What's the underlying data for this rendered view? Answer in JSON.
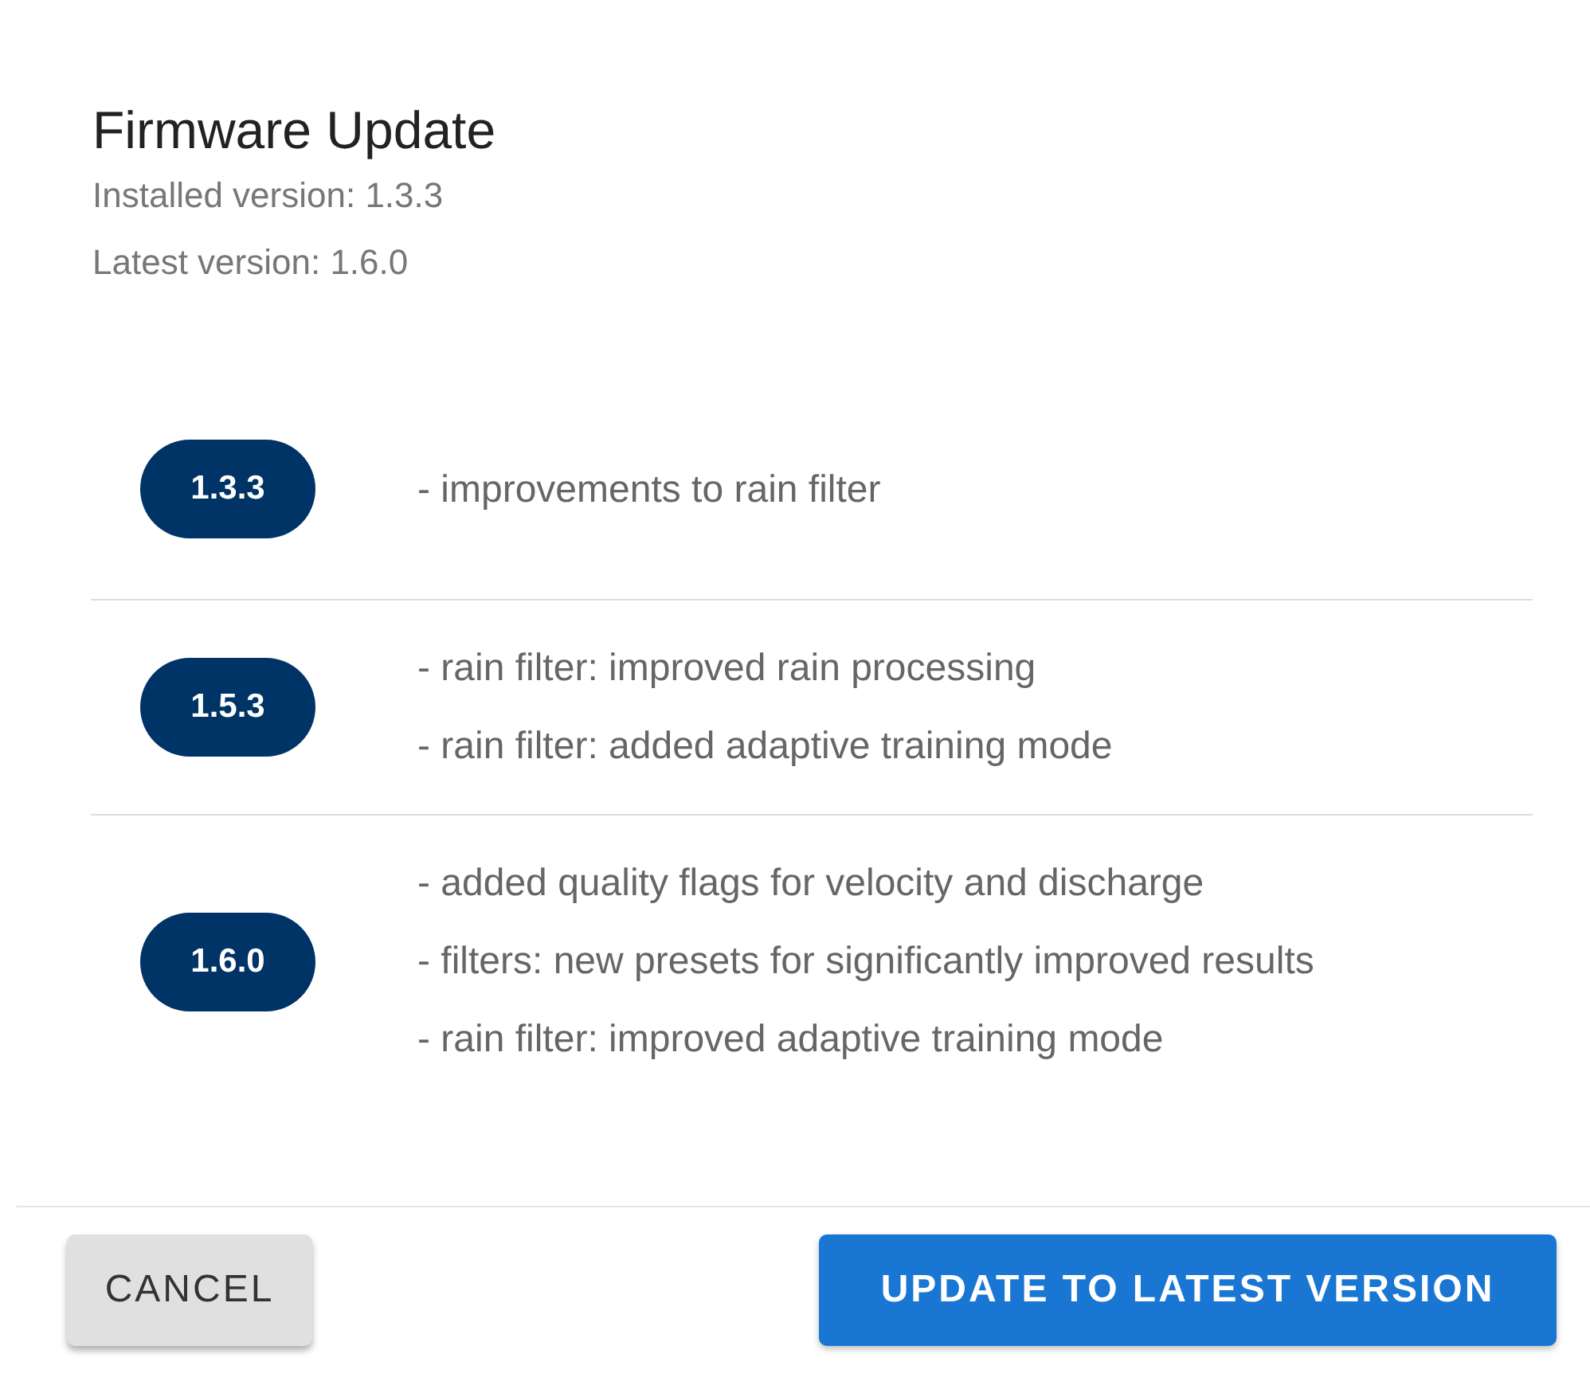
{
  "dialog": {
    "title": "Firmware Update",
    "installed": "Installed version: 1.3.3",
    "latest": "Latest version: 1.6.0"
  },
  "releases": [
    {
      "version": "1.3.3",
      "notes": [
        "- improvements to rain filter"
      ]
    },
    {
      "version": "1.5.3",
      "notes": [
        "- rain filter: improved rain processing",
        "- rain filter: added adaptive training mode"
      ]
    },
    {
      "version": "1.6.0",
      "notes": [
        "- added quality flags for velocity and discharge",
        "- filters: new presets for significantly improved results",
        "- rain filter: improved adaptive training mode"
      ]
    }
  ],
  "buttons": {
    "cancel": "CANCEL",
    "update": "UPDATE TO LATEST VERSION"
  }
}
